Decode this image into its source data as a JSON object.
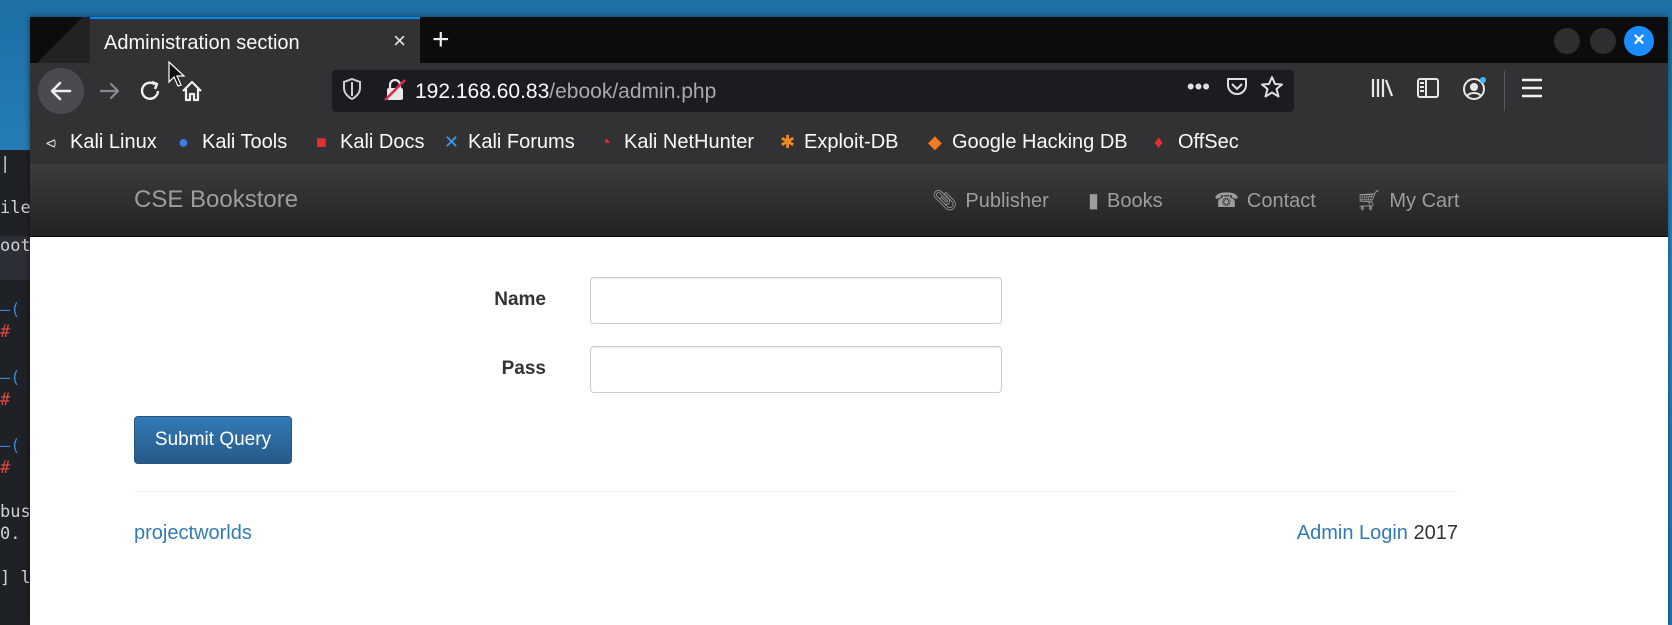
{
  "background_terminal": {
    "lines": [
      "|",
      "ile",
      "oot",
      "—(",
      "#",
      "—(",
      "#",
      "—(",
      "#",
      "bus",
      "0.",
      "] l"
    ]
  },
  "browser": {
    "tab_title": "Administration section",
    "tab_close": "×",
    "new_tab": "+",
    "window_close": "×",
    "url_host": "192.168.60.83",
    "url_path": "/ebook/admin.php",
    "url_more": "•••",
    "bookmarks": [
      {
        "icon": "kali-dragon-icon",
        "label": "Kali Linux"
      },
      {
        "icon": "kali-tools-icon",
        "label": "Kali Tools"
      },
      {
        "icon": "kali-docs-icon",
        "label": "Kali Docs"
      },
      {
        "icon": "kali-forums-icon",
        "label": "Kali Forums"
      },
      {
        "icon": "kali-nethunter-icon",
        "label": "Kali NetHunter"
      },
      {
        "icon": "exploit-db-icon",
        "label": "Exploit-DB"
      },
      {
        "icon": "google-hacking-db-icon",
        "label": "Google Hacking DB"
      },
      {
        "icon": "offsec-icon",
        "label": "OffSec"
      }
    ]
  },
  "site": {
    "brand": "CSE Bookstore",
    "nav": {
      "publisher": "Publisher",
      "books": "Books",
      "contact": "Contact",
      "cart": "My Cart"
    },
    "form": {
      "name_label": "Name",
      "pass_label": "Pass",
      "name_value": "",
      "pass_value": "",
      "submit": "Submit Query"
    },
    "footer": {
      "left": "projectworlds",
      "admin_link": "Admin Login",
      "year": " 2017"
    }
  },
  "colors": {
    "tab_accent": "#0a84ff",
    "link": "#337ab7",
    "button": "#337ab7",
    "navbar": "#222222"
  }
}
